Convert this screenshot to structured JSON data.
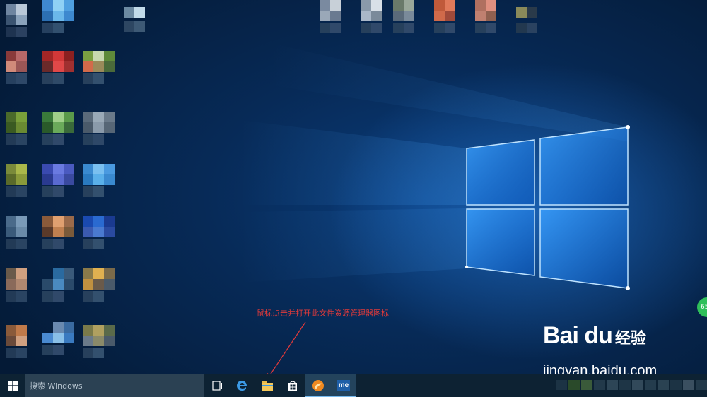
{
  "annotation": {
    "text": "鼠标点击并打开此文件资源管理器图标"
  },
  "edge_badge": {
    "text": "65"
  },
  "watermark": {
    "brand": "Bai du",
    "cn": "经验",
    "url": "jingyan.baidu.com"
  },
  "taskbar": {
    "search_placeholder": "搜索 Windows",
    "buttons": [
      {
        "name": "task-view",
        "icon": "task-view-icon"
      },
      {
        "name": "edge",
        "icon": "edge-icon"
      },
      {
        "name": "file-explorer",
        "icon": "folder-icon"
      },
      {
        "name": "store",
        "icon": "store-icon"
      },
      {
        "name": "app-orange",
        "icon": "orange-app-icon"
      },
      {
        "name": "app-me",
        "icon": "me-app-icon",
        "label": "me"
      }
    ]
  },
  "colors": {
    "taskbar": "#0d2233",
    "accent": "#76b9ed",
    "annotation": "#e23a3a"
  }
}
